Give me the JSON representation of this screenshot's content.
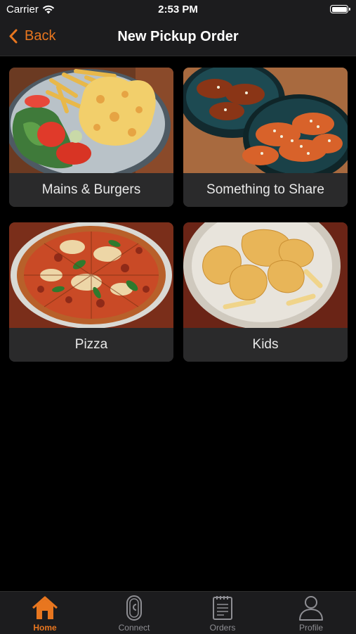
{
  "status_bar": {
    "carrier": "Carrier",
    "time": "2:53 PM"
  },
  "nav": {
    "back_label": "Back",
    "title": "New Pickup Order"
  },
  "categories": [
    {
      "label": "Mains & Burgers"
    },
    {
      "label": "Something to Share"
    },
    {
      "label": "Pizza"
    },
    {
      "label": "Kids"
    }
  ],
  "tabs": [
    {
      "label": "Home",
      "icon": "home-icon",
      "active": true
    },
    {
      "label": "Connect",
      "icon": "connect-icon",
      "active": false
    },
    {
      "label": "Orders",
      "icon": "orders-icon",
      "active": false
    },
    {
      "label": "Profile",
      "icon": "profile-icon",
      "active": false
    }
  ],
  "colors": {
    "accent": "#e8761f",
    "background": "#000000",
    "bar": "#1c1c1e",
    "tile": "#2a2a2b"
  }
}
